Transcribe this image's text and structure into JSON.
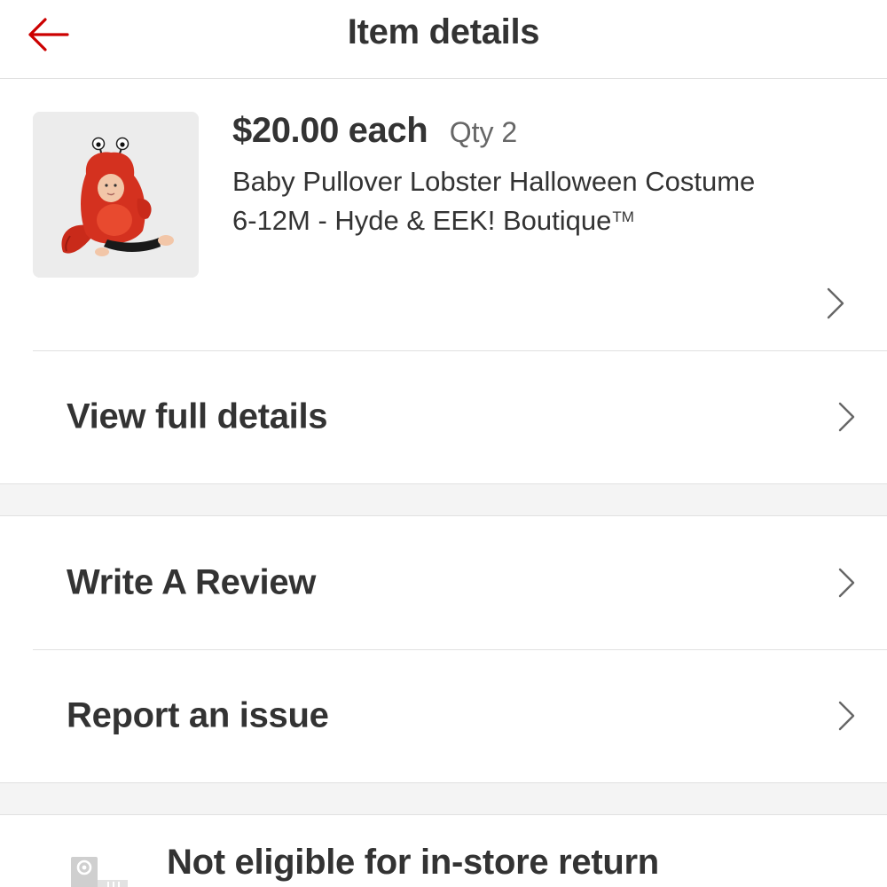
{
  "header": {
    "title": "Item details",
    "back_icon": "arrow-left-icon",
    "accent_color": "#cc0000"
  },
  "product": {
    "price": "$20.00 each",
    "qty": "Qty 2",
    "title": "Baby Pullover Lobster Halloween Costume 6-12M - Hyde & EEK! Boutique",
    "trademark": "TM",
    "image_icon": "product-thumbnail-lobster-costume"
  },
  "menu": {
    "view_full_details": "View full details",
    "write_review": "Write A Review",
    "report_issue": "Report an issue"
  },
  "return_policy": {
    "text": "Not eligible for in-store return",
    "icon": "store-return-icon"
  }
}
